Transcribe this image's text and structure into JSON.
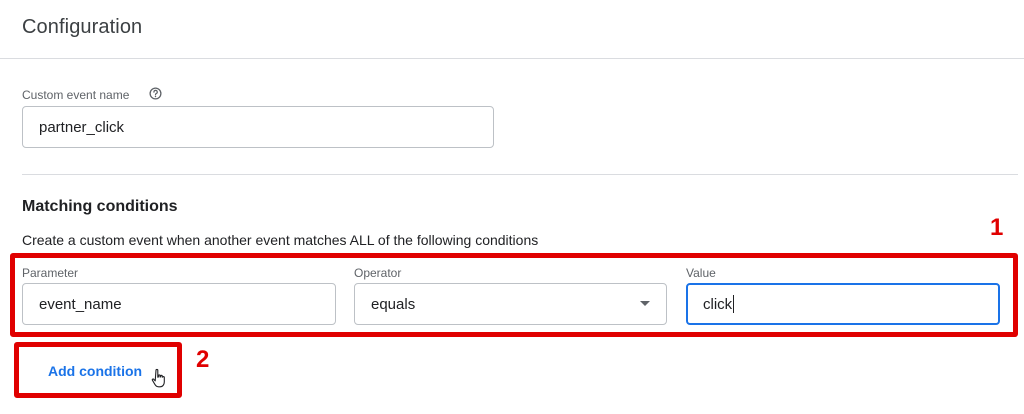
{
  "header": {
    "title": "Configuration"
  },
  "custom_event": {
    "label": "Custom event name",
    "value": "partner_click"
  },
  "matching": {
    "title": "Matching conditions",
    "description": "Create a custom event when another event matches ALL of the following conditions",
    "parameter": {
      "label": "Parameter",
      "value": "event_name"
    },
    "operator": {
      "label": "Operator",
      "value": "equals"
    },
    "value_field": {
      "label": "Value",
      "value": "click"
    }
  },
  "actions": {
    "add_condition_label": "Add condition"
  },
  "annotations": {
    "marker_1": "1",
    "marker_2": "2"
  },
  "colors": {
    "accent": "#1a73e8",
    "annotation": "#e00000"
  }
}
